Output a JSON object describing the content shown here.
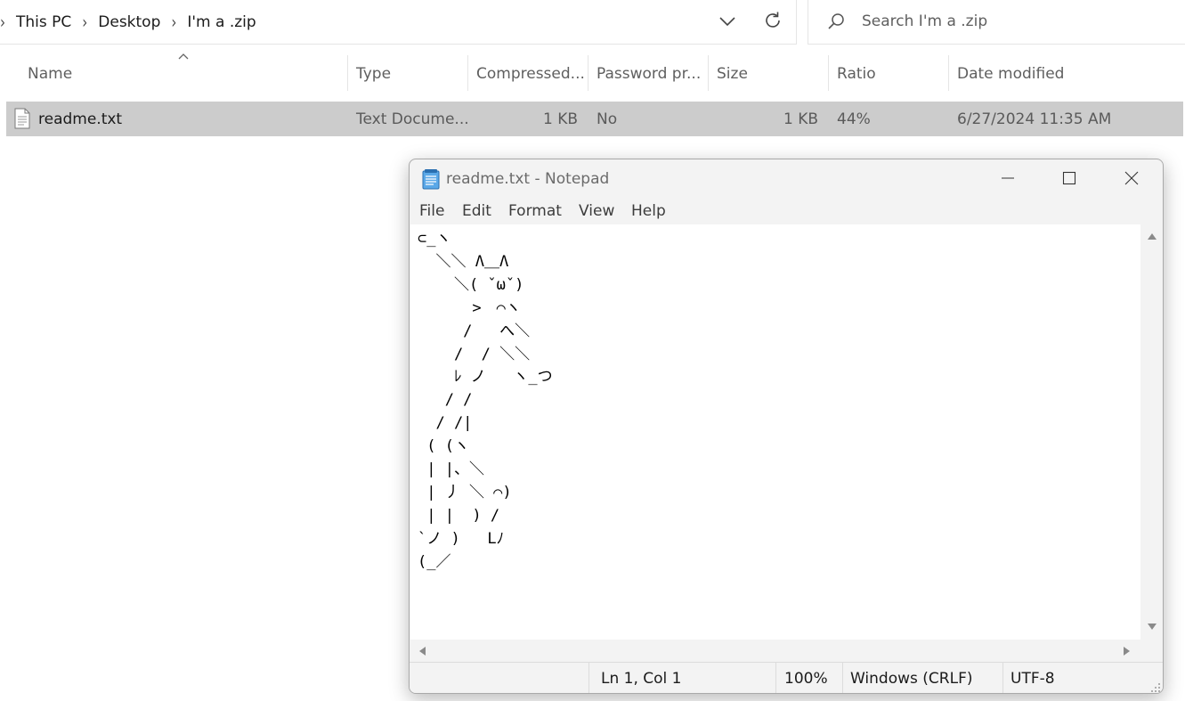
{
  "explorer": {
    "breadcrumb": [
      "This PC",
      "Desktop",
      "I'm a .zip"
    ],
    "search_placeholder": "Search I'm a .zip",
    "columns": [
      "Name",
      "Type",
      "Compressed...",
      "Password pr...",
      "Size",
      "Ratio",
      "Date modified"
    ],
    "files": [
      {
        "name": "readme.txt",
        "type": "Text Docume...",
        "compressed": "1 KB",
        "password": "No",
        "size": "1 KB",
        "ratio": "44%",
        "date": "6/27/2024 11:35 AM"
      }
    ],
    "selected_row_color": "#cccccc"
  },
  "notepad": {
    "title": "readme.txt - Notepad",
    "menu": [
      "File",
      "Edit",
      "Format",
      "View",
      "Help"
    ],
    "content": "⊂_ヽ\n  ＼＼ Λ＿Λ\n    ＼( ˇωˇ)\n      >　⌒ヽ\n     /   へ＼\n    /  / ＼＼\n    ﾚ ノ   ヽ_つ\n   / /\n  / /|\n ( (ヽ\n | |、＼\n | 丿 ＼ ⌒)\n | |  ) /\n`ノ )   Lﾉ\n(_／",
    "status": {
      "position": "Ln 1, Col 1",
      "zoom": "100%",
      "line_ending": "Windows (CRLF)",
      "encoding": "UTF-8"
    }
  },
  "icons": [
    "chevron-right-icon",
    "chevron-down-icon",
    "refresh-icon",
    "search-icon",
    "sort-up-icon",
    "text-file-icon",
    "notepad-app-icon",
    "minimize-icon",
    "maximize-icon",
    "close-icon",
    "scroll-up-icon",
    "scroll-down-icon",
    "scroll-left-icon",
    "scroll-right-icon",
    "resize-grip-icon"
  ]
}
